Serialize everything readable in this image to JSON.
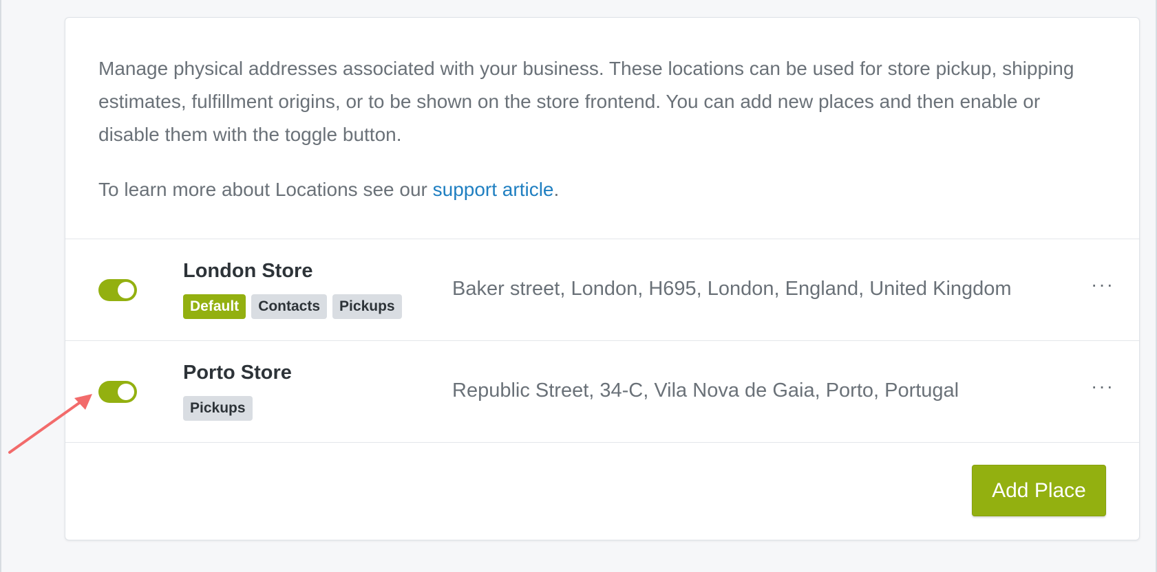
{
  "intro": {
    "description": "Manage physical addresses associated with your business. These locations can be used for store pickup, shipping estimates, fulfillment origins, or to be shown on the store frontend. You can add new places and then enable or disable them with the toggle button.",
    "learn_more_prefix": "To learn more about Locations see our ",
    "learn_more_link": "support article",
    "learn_more_suffix": "."
  },
  "locations": [
    {
      "name": "London Store",
      "enabled": true,
      "badges": [
        "Default",
        "Contacts",
        "Pickups"
      ],
      "address": "Baker street, London, H695, London, England, United Kingdom",
      "more": "···"
    },
    {
      "name": "Porto Store",
      "enabled": true,
      "badges": [
        "Pickups"
      ],
      "address": "Republic Street, 34-C, Vila Nova de Gaia, Porto, Portugal",
      "more": "···"
    }
  ],
  "footer": {
    "add_label": "Add Place"
  },
  "colors": {
    "accent": "#93b010",
    "link": "#1f7fc1",
    "annotation_arrow": "#f26b6b"
  }
}
